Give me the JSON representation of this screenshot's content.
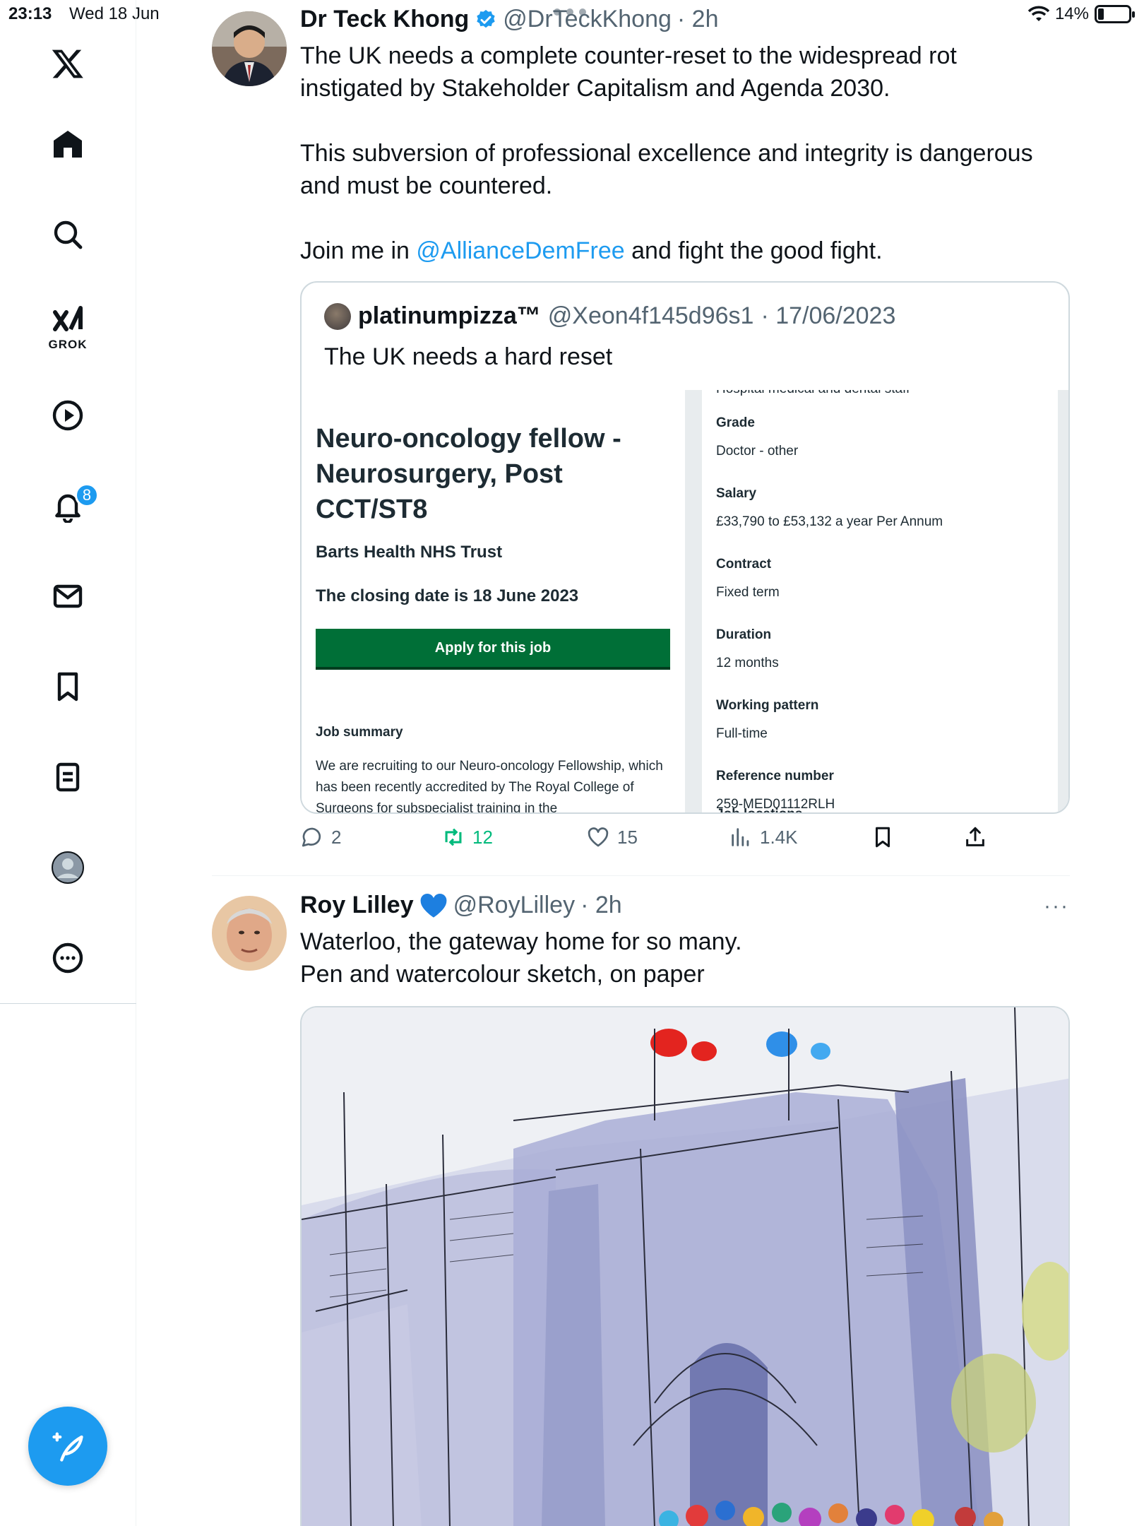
{
  "status": {
    "time": "23:13",
    "date": "Wed 18 Jun",
    "battery": "14%"
  },
  "sidebar": {
    "grok_label": "GROK",
    "notification_count": "8"
  },
  "tweet1": {
    "name": "Dr Teck Khong",
    "handle": "@DrTeckKhong",
    "time": "· 2h",
    "text_p1": "The UK needs a complete counter-reset to the widespread rot\ninstigated by Stakeholder Capitalism and Agenda 2030.",
    "text_p2": "This subversion of professional excellence and integrity is dangerous\nand must be countered.",
    "text_p3_pre": "Join me in ",
    "text_p3_link": "@AllianceDemFree",
    "text_p3_post": " and fight the good fight.",
    "quote": {
      "name": "platinumpizza™",
      "handle": "@Xeon4f145d96s1",
      "date": "· 17/06/2023",
      "text": "The UK needs a hard reset",
      "job": {
        "cut_text": "Hospital medical and dental staff",
        "title": "Neuro-oncology fellow - Neurosurgery, Post CCT/ST8",
        "org": "Barts Health NHS Trust",
        "closing": "The closing date is 18 June 2023",
        "apply": "Apply for this job",
        "summary_heading": "Job summary",
        "summary": "We are recruiting to our Neuro-oncology Fellowship, which has been recently accredited by The Royal College of Surgeons for subspecialist training in the",
        "fields": [
          {
            "k": "Grade",
            "v": "Doctor - other"
          },
          {
            "k": "Salary",
            "v": "£33,790 to £53,132 a year Per Annum"
          },
          {
            "k": "Contract",
            "v": "Fixed term"
          },
          {
            "k": "Duration",
            "v": "12 months"
          },
          {
            "k": "Working pattern",
            "v": "Full-time"
          },
          {
            "k": "Reference number",
            "v": "259-MED01112RLH"
          }
        ],
        "tail": "Job locations"
      }
    },
    "actions": {
      "replies": "2",
      "reposts": "12",
      "likes": "15",
      "views": "1.4K"
    }
  },
  "tweet2": {
    "name": "Roy Lilley",
    "handle": "@RoyLilley",
    "time": "· 2h",
    "more": "···",
    "text": "Waterloo, the gateway home for so many.\nPen and watercolour sketch, on paper"
  },
  "colors": {
    "accent": "#1d9bf0",
    "repost_green": "#00ba7c",
    "nhs_green": "#006f37"
  }
}
